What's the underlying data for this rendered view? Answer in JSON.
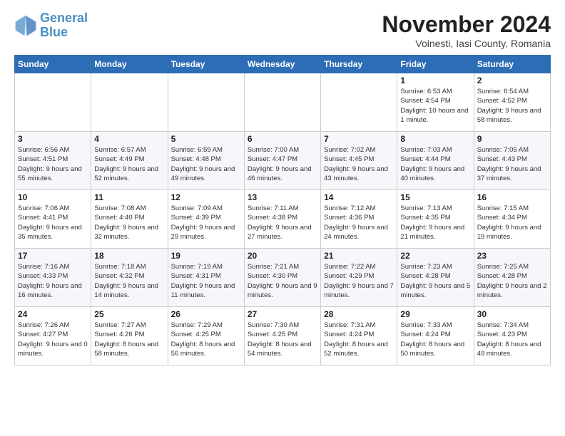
{
  "header": {
    "logo_line1": "General",
    "logo_line2": "Blue",
    "month": "November 2024",
    "location": "Voinesti, Iasi County, Romania"
  },
  "weekdays": [
    "Sunday",
    "Monday",
    "Tuesday",
    "Wednesday",
    "Thursday",
    "Friday",
    "Saturday"
  ],
  "weeks": [
    [
      {
        "day": "",
        "info": ""
      },
      {
        "day": "",
        "info": ""
      },
      {
        "day": "",
        "info": ""
      },
      {
        "day": "",
        "info": ""
      },
      {
        "day": "",
        "info": ""
      },
      {
        "day": "1",
        "info": "Sunrise: 6:53 AM\nSunset: 4:54 PM\nDaylight: 10 hours and 1 minute."
      },
      {
        "day": "2",
        "info": "Sunrise: 6:54 AM\nSunset: 4:52 PM\nDaylight: 9 hours and 58 minutes."
      }
    ],
    [
      {
        "day": "3",
        "info": "Sunrise: 6:56 AM\nSunset: 4:51 PM\nDaylight: 9 hours and 55 minutes."
      },
      {
        "day": "4",
        "info": "Sunrise: 6:57 AM\nSunset: 4:49 PM\nDaylight: 9 hours and 52 minutes."
      },
      {
        "day": "5",
        "info": "Sunrise: 6:59 AM\nSunset: 4:48 PM\nDaylight: 9 hours and 49 minutes."
      },
      {
        "day": "6",
        "info": "Sunrise: 7:00 AM\nSunset: 4:47 PM\nDaylight: 9 hours and 46 minutes."
      },
      {
        "day": "7",
        "info": "Sunrise: 7:02 AM\nSunset: 4:45 PM\nDaylight: 9 hours and 43 minutes."
      },
      {
        "day": "8",
        "info": "Sunrise: 7:03 AM\nSunset: 4:44 PM\nDaylight: 9 hours and 40 minutes."
      },
      {
        "day": "9",
        "info": "Sunrise: 7:05 AM\nSunset: 4:43 PM\nDaylight: 9 hours and 37 minutes."
      }
    ],
    [
      {
        "day": "10",
        "info": "Sunrise: 7:06 AM\nSunset: 4:41 PM\nDaylight: 9 hours and 35 minutes."
      },
      {
        "day": "11",
        "info": "Sunrise: 7:08 AM\nSunset: 4:40 PM\nDaylight: 9 hours and 32 minutes."
      },
      {
        "day": "12",
        "info": "Sunrise: 7:09 AM\nSunset: 4:39 PM\nDaylight: 9 hours and 29 minutes."
      },
      {
        "day": "13",
        "info": "Sunrise: 7:11 AM\nSunset: 4:38 PM\nDaylight: 9 hours and 27 minutes."
      },
      {
        "day": "14",
        "info": "Sunrise: 7:12 AM\nSunset: 4:36 PM\nDaylight: 9 hours and 24 minutes."
      },
      {
        "day": "15",
        "info": "Sunrise: 7:13 AM\nSunset: 4:35 PM\nDaylight: 9 hours and 21 minutes."
      },
      {
        "day": "16",
        "info": "Sunrise: 7:15 AM\nSunset: 4:34 PM\nDaylight: 9 hours and 19 minutes."
      }
    ],
    [
      {
        "day": "17",
        "info": "Sunrise: 7:16 AM\nSunset: 4:33 PM\nDaylight: 9 hours and 16 minutes."
      },
      {
        "day": "18",
        "info": "Sunrise: 7:18 AM\nSunset: 4:32 PM\nDaylight: 9 hours and 14 minutes."
      },
      {
        "day": "19",
        "info": "Sunrise: 7:19 AM\nSunset: 4:31 PM\nDaylight: 9 hours and 11 minutes."
      },
      {
        "day": "20",
        "info": "Sunrise: 7:21 AM\nSunset: 4:30 PM\nDaylight: 9 hours and 9 minutes."
      },
      {
        "day": "21",
        "info": "Sunrise: 7:22 AM\nSunset: 4:29 PM\nDaylight: 9 hours and 7 minutes."
      },
      {
        "day": "22",
        "info": "Sunrise: 7:23 AM\nSunset: 4:28 PM\nDaylight: 9 hours and 5 minutes."
      },
      {
        "day": "23",
        "info": "Sunrise: 7:25 AM\nSunset: 4:28 PM\nDaylight: 9 hours and 2 minutes."
      }
    ],
    [
      {
        "day": "24",
        "info": "Sunrise: 7:26 AM\nSunset: 4:27 PM\nDaylight: 9 hours and 0 minutes."
      },
      {
        "day": "25",
        "info": "Sunrise: 7:27 AM\nSunset: 4:26 PM\nDaylight: 8 hours and 58 minutes."
      },
      {
        "day": "26",
        "info": "Sunrise: 7:29 AM\nSunset: 4:25 PM\nDaylight: 8 hours and 56 minutes."
      },
      {
        "day": "27",
        "info": "Sunrise: 7:30 AM\nSunset: 4:25 PM\nDaylight: 8 hours and 54 minutes."
      },
      {
        "day": "28",
        "info": "Sunrise: 7:31 AM\nSunset: 4:24 PM\nDaylight: 8 hours and 52 minutes."
      },
      {
        "day": "29",
        "info": "Sunrise: 7:33 AM\nSunset: 4:24 PM\nDaylight: 8 hours and 50 minutes."
      },
      {
        "day": "30",
        "info": "Sunrise: 7:34 AM\nSunset: 4:23 PM\nDaylight: 8 hours and 49 minutes."
      }
    ]
  ]
}
